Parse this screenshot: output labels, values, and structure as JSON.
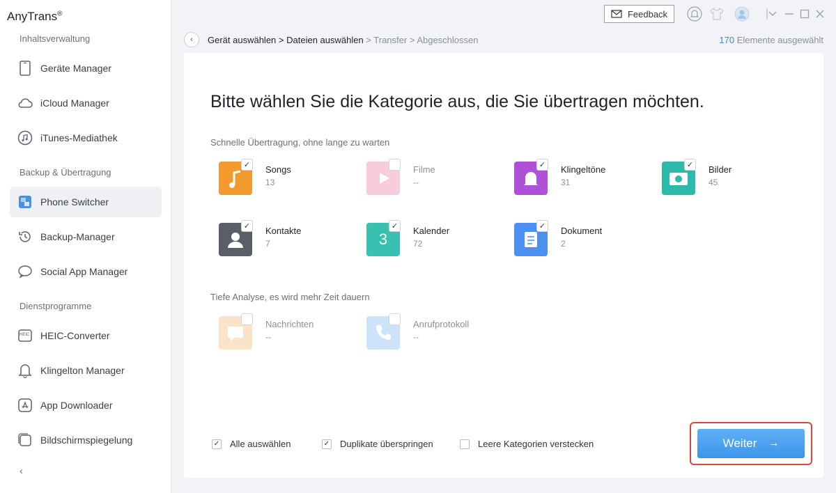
{
  "app": {
    "name": "AnyTrans",
    "reg": "®"
  },
  "sidebar": {
    "sections": [
      {
        "label": "Inhaltsverwaltung"
      },
      {
        "label": "Backup & Übertragung"
      },
      {
        "label": "Dienstprogramme"
      }
    ],
    "items": [
      {
        "label": "Geräte Manager",
        "icon": "phone-icon"
      },
      {
        "label": "iCloud Manager",
        "icon": "cloud-icon"
      },
      {
        "label": "iTunes-Mediathek",
        "icon": "music-note-icon"
      },
      {
        "label": "Phone Switcher",
        "icon": "phone-switcher-icon",
        "active": true
      },
      {
        "label": "Backup-Manager",
        "icon": "history-icon"
      },
      {
        "label": "Social App Manager",
        "icon": "chat-bubble-icon"
      },
      {
        "label": "HEIC-Converter",
        "icon": "heic-icon",
        "icon_text": "HEIC"
      },
      {
        "label": "Klingelton Manager",
        "icon": "bell-icon"
      },
      {
        "label": "App Downloader",
        "icon": "app-store-icon"
      },
      {
        "label": "Bildschirmspiegelung",
        "icon": "screen-mirror-icon"
      }
    ],
    "collapse_glyph": "‹"
  },
  "topbar": {
    "feedback_label": "Feedback",
    "icons": [
      "notification-bell-icon",
      "shirt-icon",
      "user-avatar-icon",
      "chevron-down-icon",
      "minimize-icon",
      "maximize-icon",
      "close-icon"
    ]
  },
  "breadcrumb": {
    "back_glyph": "‹",
    "step1": "Gerät auswählen",
    "step2": "Dateien auswählen",
    "step3": "Transfer",
    "step4": "Abgeschlossen",
    "sep": " > "
  },
  "selection": {
    "count": "170",
    "suffix": " Elemente ausgewählt"
  },
  "main": {
    "heading": "Bitte wählen Sie die Kategorie aus, die Sie übertragen möchten.",
    "quick_label": "Schnelle Übertragung, ohne lange zu warten",
    "deep_label": "Tiefe Analyse, es wird mehr Zeit dauern",
    "quick_categories": [
      {
        "name": "Songs",
        "count": "13",
        "checked": true,
        "color": "#f29a2e",
        "icon": "song-icon"
      },
      {
        "name": "Filme",
        "count": "--",
        "checked": false,
        "color": "#f08fb6",
        "icon": "movie-icon"
      },
      {
        "name": "Klingeltöne",
        "count": "31",
        "checked": true,
        "color": "#b04fd8",
        "icon": "ringtone-icon"
      },
      {
        "name": "Bilder",
        "count": "45",
        "checked": true,
        "color": "#2fb9a8",
        "icon": "camera-icon"
      },
      {
        "name": "Kontakte",
        "count": "7",
        "checked": true,
        "color": "#5a5e66",
        "icon": "contact-icon"
      },
      {
        "name": "Kalender",
        "count": "72",
        "checked": true,
        "color": "#38c0b0",
        "icon": "calendar-icon",
        "glyph": "3"
      },
      {
        "name": "Dokument",
        "count": "2",
        "checked": true,
        "color": "#4b8ff0",
        "icon": "document-icon"
      }
    ],
    "deep_categories": [
      {
        "name": "Nachrichten",
        "count": "--",
        "checked": false,
        "color": "#f5c38a",
        "icon": "message-icon"
      },
      {
        "name": "Anrufprotokoll",
        "count": "--",
        "checked": false,
        "color": "#8fc3f5",
        "icon": "phone-call-icon"
      }
    ],
    "check_glyph": "✓"
  },
  "footer": {
    "select_all": "Alle auswählen",
    "skip_duplicates": "Duplikate überspringen",
    "hide_empty": "Leere Kategorien verstecken",
    "next_label": "Weiter",
    "next_arrow": "→"
  },
  "colors": {
    "accent": "#3c95ec",
    "highlight_border": "#e0423c"
  }
}
